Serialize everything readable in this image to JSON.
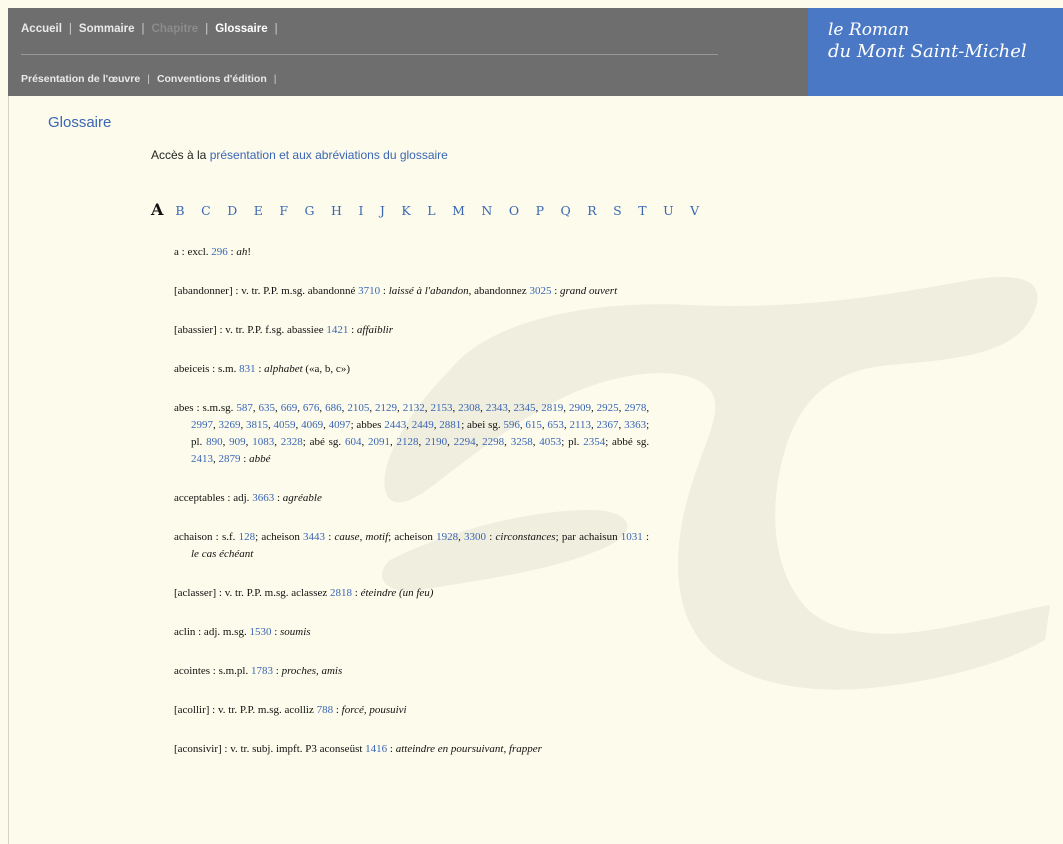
{
  "nav": {
    "row1": [
      {
        "label": "Accueil",
        "state": "normal"
      },
      {
        "label": "Sommaire",
        "state": "normal"
      },
      {
        "label": "Chapitre",
        "state": "disabled"
      },
      {
        "label": "Glossaire",
        "state": "active"
      }
    ],
    "row2": [
      {
        "label": "Présentation de l'œuvre"
      },
      {
        "label": "Conventions d'édition"
      }
    ],
    "separator": "|"
  },
  "brand": {
    "line1": "le Roman",
    "line2": "du Mont Saint-Michel"
  },
  "page": {
    "title": "Glossaire",
    "intro_prefix": "Accès à la ",
    "intro_link": "présentation et aux abréviations du glossaire"
  },
  "alphabet": {
    "current": "A",
    "letters": [
      "B",
      "C",
      "D",
      "E",
      "F",
      "G",
      "H",
      "I",
      "J",
      "K",
      "L",
      "M",
      "N",
      "O",
      "P",
      "Q",
      "R",
      "S",
      "T",
      "U",
      "V"
    ]
  },
  "colors": {
    "header_bg": "#6e6e6e",
    "brand_bg": "#4a78c4",
    "link": "#3a66b4",
    "page_bg": "#fcfbec"
  },
  "entries": [
    [
      {
        "t": "a : excl. "
      },
      {
        "t": "296",
        "l": 1
      },
      {
        "t": " : "
      },
      {
        "t": "ah",
        "i": 1
      },
      {
        "t": "!"
      }
    ],
    [
      {
        "t": "[abandonner] : v. tr. P.P. m.sg. abandonné "
      },
      {
        "t": "3710",
        "l": 1
      },
      {
        "t": " : "
      },
      {
        "t": "laissé à l'abandon",
        "i": 1
      },
      {
        "t": ", abandonnez "
      },
      {
        "t": "3025",
        "l": 1
      },
      {
        "t": " : "
      },
      {
        "t": "grand ouvert",
        "i": 1
      }
    ],
    [
      {
        "t": "[abassier] : v. tr. P.P. f.sg. abassiee "
      },
      {
        "t": "1421",
        "l": 1
      },
      {
        "t": " : "
      },
      {
        "t": "affaiblir",
        "i": 1
      }
    ],
    [
      {
        "t": "abeiceis : s.m. "
      },
      {
        "t": "831",
        "l": 1
      },
      {
        "t": " : "
      },
      {
        "t": "alphabet",
        "i": 1
      },
      {
        "t": " («a, b, c»)"
      }
    ],
    [
      {
        "t": "abes : s.m.sg. "
      },
      {
        "t": "587",
        "l": 1
      },
      {
        "t": ", "
      },
      {
        "t": "635",
        "l": 1
      },
      {
        "t": ", "
      },
      {
        "t": "669",
        "l": 1
      },
      {
        "t": ", "
      },
      {
        "t": "676",
        "l": 1
      },
      {
        "t": ", "
      },
      {
        "t": "686",
        "l": 1
      },
      {
        "t": ", "
      },
      {
        "t": "2105",
        "l": 1
      },
      {
        "t": ", "
      },
      {
        "t": "2129",
        "l": 1
      },
      {
        "t": ", "
      },
      {
        "t": "2132",
        "l": 1
      },
      {
        "t": ", "
      },
      {
        "t": "2153",
        "l": 1
      },
      {
        "t": ", "
      },
      {
        "t": "2308",
        "l": 1
      },
      {
        "t": ", "
      },
      {
        "t": "2343",
        "l": 1
      },
      {
        "t": ", "
      },
      {
        "t": "2345",
        "l": 1
      },
      {
        "t": ", "
      },
      {
        "t": "2819",
        "l": 1
      },
      {
        "t": ", "
      },
      {
        "t": "2909",
        "l": 1
      },
      {
        "t": ", "
      },
      {
        "t": "2925",
        "l": 1
      },
      {
        "t": ", "
      },
      {
        "t": "2978",
        "l": 1
      },
      {
        "t": ", "
      },
      {
        "t": "2997",
        "l": 1
      },
      {
        "t": ", "
      },
      {
        "t": "3269",
        "l": 1
      },
      {
        "t": ", "
      },
      {
        "t": "3815",
        "l": 1
      },
      {
        "t": ", "
      },
      {
        "t": "4059",
        "l": 1
      },
      {
        "t": ", "
      },
      {
        "t": "4069",
        "l": 1
      },
      {
        "t": ", "
      },
      {
        "t": "4097",
        "l": 1
      },
      {
        "t": "; abbes "
      },
      {
        "t": "2443",
        "l": 1
      },
      {
        "t": ", "
      },
      {
        "t": "2449",
        "l": 1
      },
      {
        "t": ", "
      },
      {
        "t": "2881",
        "l": 1
      },
      {
        "t": "; abei sg. "
      },
      {
        "t": "596",
        "l": 1
      },
      {
        "t": ", "
      },
      {
        "t": "615",
        "l": 1
      },
      {
        "t": ", "
      },
      {
        "t": "653",
        "l": 1
      },
      {
        "t": ", "
      },
      {
        "t": "2113",
        "l": 1
      },
      {
        "t": ", "
      },
      {
        "t": "2367",
        "l": 1
      },
      {
        "t": ", "
      },
      {
        "t": "3363",
        "l": 1
      },
      {
        "t": "; pl. "
      },
      {
        "t": "890",
        "l": 1
      },
      {
        "t": ", "
      },
      {
        "t": "909",
        "l": 1
      },
      {
        "t": ", "
      },
      {
        "t": "1083",
        "l": 1
      },
      {
        "t": ", "
      },
      {
        "t": "2328",
        "l": 1
      },
      {
        "t": "; abé sg. "
      },
      {
        "t": "604",
        "l": 1
      },
      {
        "t": ", "
      },
      {
        "t": "2091",
        "l": 1
      },
      {
        "t": ", "
      },
      {
        "t": "2128",
        "l": 1
      },
      {
        "t": ", "
      },
      {
        "t": "2190",
        "l": 1
      },
      {
        "t": ", "
      },
      {
        "t": "2294",
        "l": 1
      },
      {
        "t": ", "
      },
      {
        "t": "2298",
        "l": 1
      },
      {
        "t": ", "
      },
      {
        "t": "3258",
        "l": 1
      },
      {
        "t": ", "
      },
      {
        "t": "4053",
        "l": 1
      },
      {
        "t": "; pl. "
      },
      {
        "t": "2354",
        "l": 1
      },
      {
        "t": "; abbé sg. "
      },
      {
        "t": "2413",
        "l": 1
      },
      {
        "t": ", "
      },
      {
        "t": "2879",
        "l": 1
      },
      {
        "t": " : "
      },
      {
        "t": "abbé",
        "i": 1
      }
    ],
    [
      {
        "t": "acceptables : adj. "
      },
      {
        "t": "3663",
        "l": 1
      },
      {
        "t": " : "
      },
      {
        "t": "agréable",
        "i": 1
      }
    ],
    [
      {
        "t": "achaison : s.f. "
      },
      {
        "t": "128",
        "l": 1
      },
      {
        "t": "; acheison "
      },
      {
        "t": "3443",
        "l": 1
      },
      {
        "t": " : "
      },
      {
        "t": "cause",
        "i": 1
      },
      {
        "t": ", "
      },
      {
        "t": "motif",
        "i": 1
      },
      {
        "t": "; acheison "
      },
      {
        "t": "1928",
        "l": 1
      },
      {
        "t": ", "
      },
      {
        "t": "3300",
        "l": 1
      },
      {
        "t": " : "
      },
      {
        "t": "circonstances",
        "i": 1
      },
      {
        "t": "; par achaisun "
      },
      {
        "t": "1031",
        "l": 1
      },
      {
        "t": " : "
      },
      {
        "t": "le cas échéant",
        "i": 1
      }
    ],
    [
      {
        "t": "[aclasser] : v. tr. P.P. m.sg. aclassez "
      },
      {
        "t": "2818",
        "l": 1
      },
      {
        "t": " : "
      },
      {
        "t": "éteindre (un feu)",
        "i": 1
      }
    ],
    [
      {
        "t": "aclin : adj. m.sg. "
      },
      {
        "t": "1530",
        "l": 1
      },
      {
        "t": " : "
      },
      {
        "t": "soumis",
        "i": 1
      }
    ],
    [
      {
        "t": "acointes : s.m.pl. "
      },
      {
        "t": "1783",
        "l": 1
      },
      {
        "t": " : "
      },
      {
        "t": "proches, amis",
        "i": 1
      }
    ],
    [
      {
        "t": "[acollir] : v. tr. P.P. m.sg. acolliz "
      },
      {
        "t": "788",
        "l": 1
      },
      {
        "t": " : "
      },
      {
        "t": "forcé, pousuivi",
        "i": 1
      }
    ],
    [
      {
        "t": "[aconsivir] : v. tr. subj. impft. P3 aconseüst "
      },
      {
        "t": "1416",
        "l": 1
      },
      {
        "t": " : "
      },
      {
        "t": "atteindre en poursuivant, frapper",
        "i": 1
      }
    ]
  ]
}
